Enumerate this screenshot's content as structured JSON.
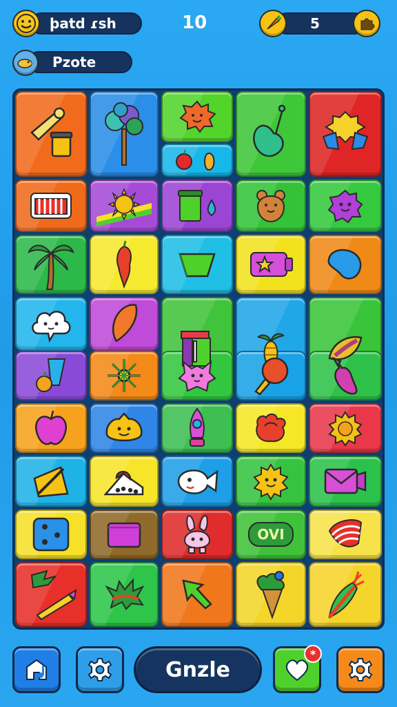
{
  "hud": {
    "player_name": "þatd ɾsh",
    "score": "10",
    "coins": "5",
    "mode_label": "Pzote"
  },
  "footer": {
    "main_button_label": "Gnzle",
    "notification_mark": "*"
  },
  "board": {
    "tiles": [
      {
        "name": "tile-bone-bucket",
        "icon": "bone-icon",
        "color": "#f26b1d"
      },
      {
        "name": "tile-tree",
        "icon": "tree-icon",
        "color": "#2b8ee8"
      },
      {
        "name": "tile-sun-face",
        "icon": "sun-face-icon",
        "color": "#53d42b"
      },
      {
        "name": "tile-fruits",
        "icon": "fruit-icon",
        "color": "#18b7ea"
      },
      {
        "name": "tile-guitar",
        "icon": "guitar-icon",
        "color": "#3fc73a"
      },
      {
        "name": "tile-trophy",
        "icon": "trophy-icon",
        "color": "#df2525"
      },
      {
        "name": "tile-comb",
        "icon": "comb-icon",
        "color": "#f06a1c"
      },
      {
        "name": "tile-sun-rainbow",
        "icon": "sun-icon",
        "color": "#a64bd6"
      },
      {
        "name": "tile-jar-drop",
        "icon": "jar-icon",
        "color": "#9b45d4"
      },
      {
        "name": "tile-bear",
        "icon": "bear-icon",
        "color": "#33c238"
      },
      {
        "name": "tile-spiky-blob",
        "icon": "blob-icon",
        "color": "#35c93f"
      },
      {
        "name": "tile-palm",
        "icon": "palm-icon",
        "color": "#2db94a"
      },
      {
        "name": "tile-chili",
        "icon": "chili-icon",
        "color": "#f6ea2e"
      },
      {
        "name": "tile-gem",
        "icon": "gem-icon",
        "color": "#1fbfe6"
      },
      {
        "name": "tile-star-card",
        "icon": "star-card-icon",
        "color": "#f2e21e"
      },
      {
        "name": "tile-bean",
        "icon": "bean-icon",
        "color": "#f08a16"
      },
      {
        "name": "tile-cloud-face",
        "icon": "cloud-face-icon",
        "color": "#22b6ec"
      },
      {
        "name": "tile-balloon",
        "icon": "balloon-icon",
        "color": "#c04bd8"
      },
      {
        "name": "tile-books",
        "icon": "books-icon",
        "color": "#41c33c"
      },
      {
        "name": "tile-sprout",
        "icon": "sprout-icon",
        "color": "#1fa7e8"
      },
      {
        "name": "tile-leaf",
        "icon": "leaf-icon",
        "color": "#39c43a"
      },
      {
        "name": "tile-cup-orange",
        "icon": "cup-icon",
        "color": "#8a4ad8"
      },
      {
        "name": "tile-snowflake",
        "icon": "snowflake-icon",
        "color": "#f48a18"
      },
      {
        "name": "tile-cat-face",
        "icon": "cat-face-icon",
        "color": "#33c63f"
      },
      {
        "name": "tile-ping-pong",
        "icon": "paddle-icon",
        "color": "#1aa2e6"
      },
      {
        "name": "tile-eggplant",
        "icon": "eggplant-icon",
        "color": "#2ec24a"
      },
      {
        "name": "tile-apple",
        "icon": "apple-icon",
        "color": "#f6a21c"
      },
      {
        "name": "tile-smile-blob",
        "icon": "smile-blob-icon",
        "color": "#2f86e6"
      },
      {
        "name": "tile-gnome",
        "icon": "gnome-icon",
        "color": "#3dbf52"
      },
      {
        "name": "tile-rose",
        "icon": "rose-icon",
        "color": "#f5e726"
      },
      {
        "name": "tile-sun-badge",
        "icon": "sun-badge-icon",
        "color": "#e8384a"
      },
      {
        "name": "tile-pencil-frame",
        "icon": "pencil-icon",
        "color": "#1fb2e6"
      },
      {
        "name": "tile-cake",
        "icon": "cake-icon",
        "color": "#f7e52a"
      },
      {
        "name": "tile-fish-face",
        "icon": "fish-icon",
        "color": "#1f9fe8"
      },
      {
        "name": "tile-sun-smile",
        "icon": "sun-smile-icon",
        "color": "#36c440"
      },
      {
        "name": "tile-envelope",
        "icon": "envelope-icon",
        "color": "#2bc24c"
      },
      {
        "name": "tile-die",
        "icon": "die-icon",
        "color": "#f6e028"
      },
      {
        "name": "tile-box",
        "icon": "box-icon",
        "color": "#8f6a2a"
      },
      {
        "name": "tile-bunny",
        "icon": "bunny-icon",
        "color": "#e02c2c"
      },
      {
        "name": "tile-label-ovi",
        "icon": "label-icon",
        "color": "#3fc23a",
        "text": "OVI"
      },
      {
        "name": "tile-flag-stripes",
        "icon": "flag-icon",
        "color": "#f7e24a"
      },
      {
        "name": "tile-leaf-crayon",
        "icon": "crayon-icon",
        "color": "#e8302a"
      },
      {
        "name": "tile-splat",
        "icon": "splat-icon",
        "color": "#2ec54a"
      },
      {
        "name": "tile-arrow",
        "icon": "arrow-icon",
        "color": "#f0771c"
      },
      {
        "name": "tile-ice-cream",
        "icon": "ice-cream-icon",
        "color": "#f4d62a"
      },
      {
        "name": "tile-carrot",
        "icon": "carrot-icon",
        "color": "#f5d42c"
      }
    ]
  },
  "colors": {
    "background": "#2aa8f2",
    "pill": "#16335e",
    "coin": "#f5c215",
    "accent_green": "#4fd12b",
    "accent_orange": "#f58a1a"
  }
}
